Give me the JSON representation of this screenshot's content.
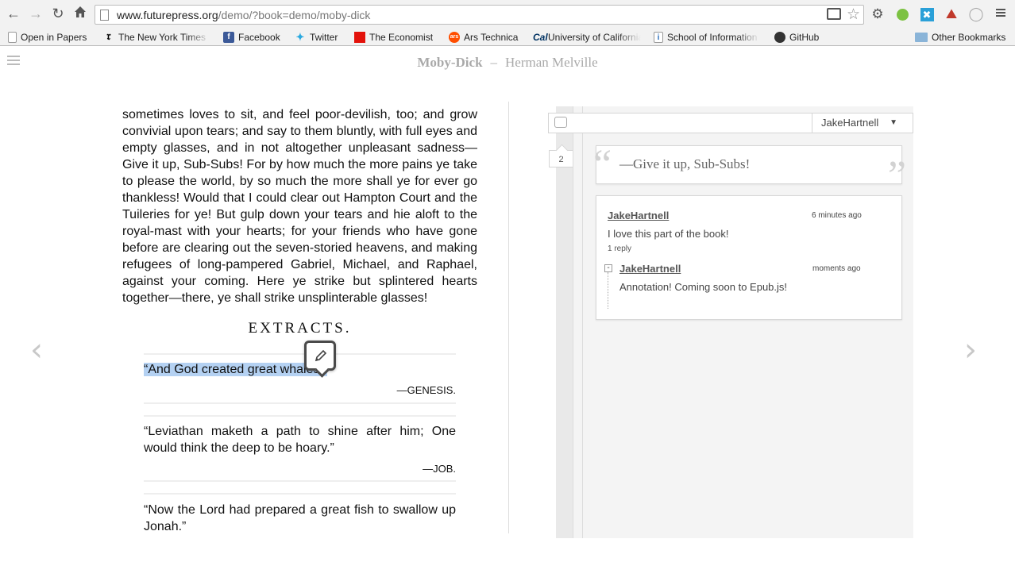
{
  "browser": {
    "url_host": "www.futurepress.org",
    "url_path": "/demo/?book=demo/moby-dick",
    "icons": {
      "back": "arrow-left-icon",
      "forward": "arrow-right-icon",
      "reload": "reload-icon",
      "home": "home-icon",
      "bookmark_star": "star-icon",
      "settings": "gear-icon",
      "menu": "hamburger-icon"
    }
  },
  "bookmarks": [
    {
      "label": "Open in Papers",
      "icon": "page-icon"
    },
    {
      "label": "The New York Times",
      "icon": "nyt-icon"
    },
    {
      "label": "Facebook",
      "icon": "facebook-icon"
    },
    {
      "label": "Twitter",
      "icon": "twitter-icon"
    },
    {
      "label": "The Economist",
      "icon": "economist-icon"
    },
    {
      "label": "Ars Technica",
      "icon": "ars-icon"
    },
    {
      "label": "University of California",
      "icon": "cal-icon"
    },
    {
      "label": "School of Information",
      "icon": "ischool-icon"
    },
    {
      "label": "GitHub",
      "icon": "github-icon"
    },
    {
      "label": "Other Bookmarks",
      "icon": "folder-icon"
    }
  ],
  "reader": {
    "title": "Moby-Dick",
    "separator": "–",
    "author": "Herman Melville",
    "prev_arrow": "‹",
    "next_arrow": "›"
  },
  "page": {
    "paragraph": "sometimes loves to sit, and feel poor-devilish, too; and grow convivial upon tears; and say to them bluntly, with full eyes and empty glasses, and in not altogether unpleasant sadness—Give it up, Sub-Subs! For by how much the more pains ye take to please the world, by so much the more shall ye for ever go thankless! Would that I could clear out Hampton Court and the Tuileries for ye! But gulp down your tears and hie aloft to the royal-mast with your hearts; for your friends who have gone before are clearing out the seven-storied heavens, and making refugees of long-pampered Gabriel, Michael, and Raphael, against your coming. Here ye strike but splintered hearts together—there, ye shall strike unsplinterable glasses!",
    "heading": "EXTRACTS.",
    "extracts": [
      {
        "text": "“And God created great whales.”",
        "attribution": "—GENESIS."
      },
      {
        "text": "“Leviathan maketh a path to shine after him; One would think the deep to be hoary.”",
        "attribution": "—JOB."
      },
      {
        "text": "“Now the Lord had prepared a great fish to swallow up Jonah.”",
        "attribution": ""
      }
    ]
  },
  "annotations": {
    "search_placeholder": "",
    "user_filter": "JakeHartnell",
    "count": "2",
    "quote": "—Give it up, Sub-Subs!",
    "comment": {
      "user": "JakeHartnell",
      "time": "6 minutes ago",
      "body": "I love this part of the book!",
      "replies_label": "1 reply"
    },
    "reply": {
      "user": "JakeHartnell",
      "time": "moments ago",
      "body": "Annotation! Coming soon to Epub.js!"
    }
  },
  "colors": {
    "highlight": "#b4d1f2",
    "panel_bg": "#f4f4f4",
    "title_gray": "#a9a9a9"
  }
}
